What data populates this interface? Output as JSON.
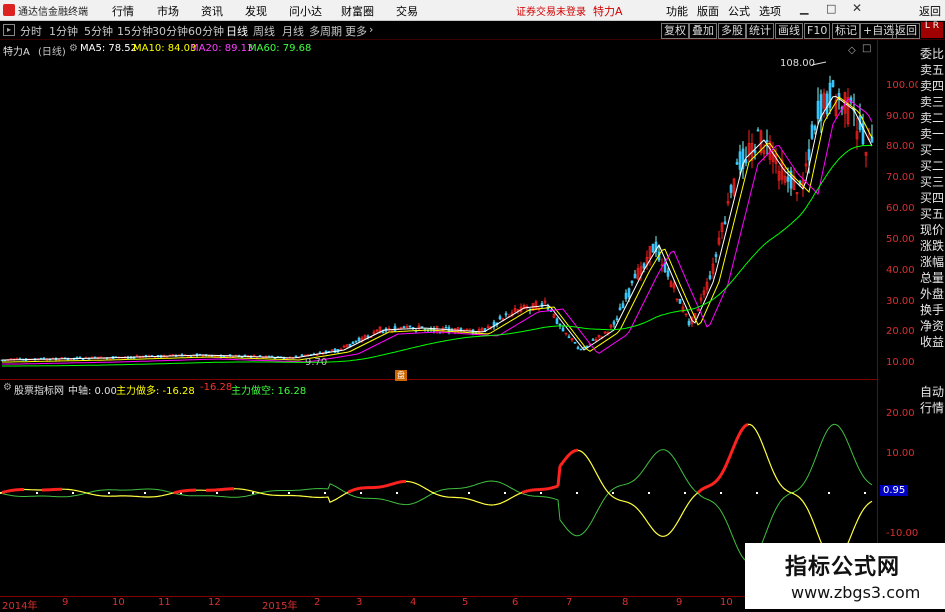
{
  "menubar": {
    "app_title": "通达信金融终端",
    "items": [
      "行情",
      "市场",
      "资讯",
      "发现",
      "问小达",
      "财富圈",
      "交易"
    ],
    "login_notice": "证券交易未登录",
    "stock_name": "特力A",
    "right_items": [
      "功能",
      "版面",
      "公式",
      "选项"
    ],
    "back": "返回"
  },
  "periods": [
    "分时",
    "1分钟",
    "5分钟",
    "15分钟",
    "30分钟",
    "60分钟",
    "日线",
    "周线",
    "月线",
    "多周期",
    "更多"
  ],
  "active_period": "日线",
  "tools": [
    "复权",
    "叠加",
    "多股",
    "统计",
    "画线",
    "F10",
    "标记",
    "+自选",
    "返回"
  ],
  "main_info": {
    "stock": "特力A",
    "period": "(日线)",
    "ma5": "MA5: 78.52",
    "ma10": "MA10: 84.03",
    "ma20": "MA20: 89.13",
    "ma60": "MA60: 79.68",
    "high_label": "108.00",
    "low_label": "9.70",
    "event_label": "盘"
  },
  "main_y_labels": [
    "100.00",
    "90.00",
    "80.00",
    "70.00",
    "60.00",
    "50.00",
    "40.00",
    "30.00",
    "20.00",
    "10.00"
  ],
  "sub_info": {
    "name": "股票指标网",
    "mid": "中轴: 0.00",
    "bull": "主力做多: -16.28",
    "val": "-16.28",
    "bear": "主力做空: 16.28"
  },
  "sub_y_labels": [
    "20.00",
    "10.00",
    "0.95",
    "-10.00"
  ],
  "side_panel": [
    "委比",
    "卖五",
    "卖四",
    "卖三",
    "卖二",
    "卖一",
    "买一",
    "买二",
    "买三",
    "买四",
    "买五",
    "现价",
    "涨跌",
    "涨幅",
    "总量",
    "外盘",
    "换手",
    "净资",
    "收益"
  ],
  "side_lower": [
    "自动",
    "行情"
  ],
  "x_labels": [
    "2014年",
    "9",
    "10",
    "11",
    "12",
    "2015年",
    "2",
    "3",
    "4",
    "5",
    "6",
    "7",
    "8",
    "9",
    "10"
  ],
  "watermark": {
    "title": "指标公式网",
    "url": "www.zbgs3.com"
  },
  "colors": {
    "up": "#ff2020",
    "down": "#40ff40",
    "ma5": "#ffffff",
    "ma10": "#ffff00",
    "ma20": "#ff00ff",
    "ma60": "#00ff00",
    "axis": "#d83030"
  }
}
